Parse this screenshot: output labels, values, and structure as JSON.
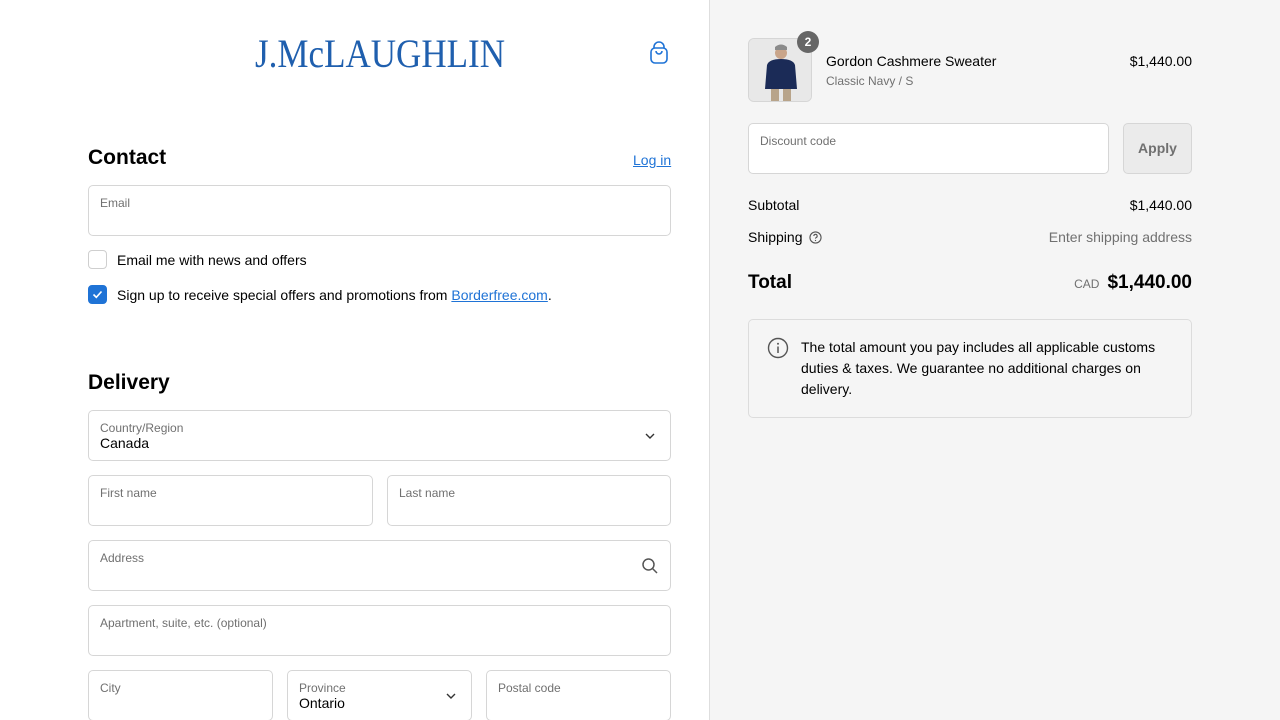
{
  "brand": {
    "logo_text": "J.McLAUGHLIN"
  },
  "contact": {
    "title": "Contact",
    "login_label": "Log in",
    "email_label": "Email",
    "email_value": "",
    "news_checkbox_label": "Email me with news and offers",
    "news_checked": false,
    "offers_checkbox_prefix": "Sign up to receive special offers and promotions from ",
    "offers_checkbox_link": "Borderfree.com",
    "offers_checkbox_suffix": ".",
    "offers_checked": true
  },
  "delivery": {
    "title": "Delivery",
    "country_label": "Country/Region",
    "country_value": "Canada",
    "first_name_label": "First name",
    "last_name_label": "Last name",
    "address_label": "Address",
    "apartment_label": "Apartment, suite, etc. (optional)",
    "city_label": "City",
    "province_label": "Province",
    "province_value": "Ontario",
    "postal_label": "Postal code"
  },
  "cart": {
    "item": {
      "quantity": "2",
      "name": "Gordon Cashmere Sweater",
      "variant": "Classic Navy / S",
      "price": "$1,440.00"
    },
    "discount_label": "Discount code",
    "apply_label": "Apply",
    "subtotal_label": "Subtotal",
    "subtotal_value": "$1,440.00",
    "shipping_label": "Shipping",
    "shipping_value": "Enter shipping address",
    "total_label": "Total",
    "total_currency": "CAD",
    "total_value": "$1,440.00",
    "info_text": "The total amount you pay includes all applicable customs duties & taxes. We guarantee no additional charges on delivery."
  },
  "colors": {
    "accent": "#1f73d6",
    "brand": "#1f5fae",
    "sidebar_bg": "#f5f5f5"
  }
}
